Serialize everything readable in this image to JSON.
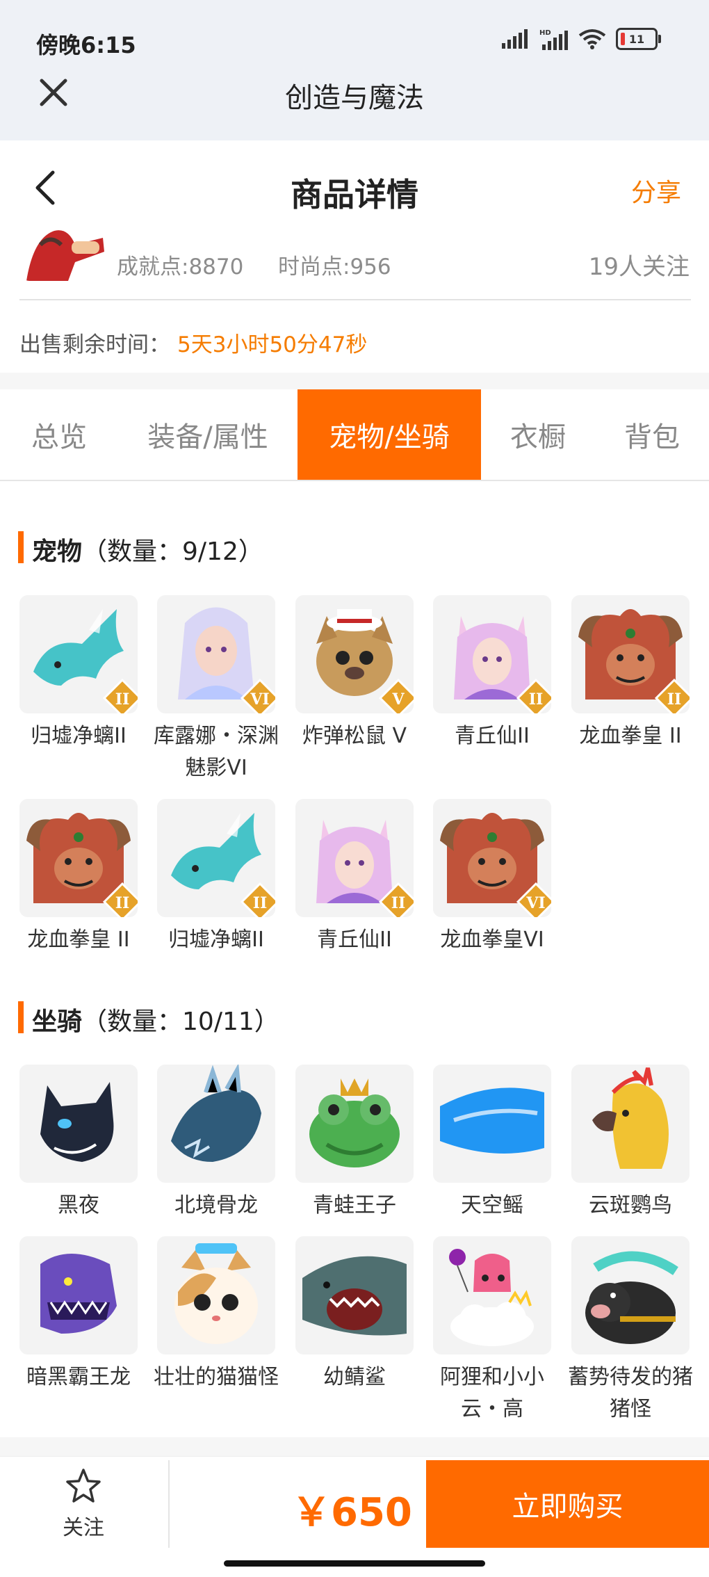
{
  "status_bar": {
    "time": "傍晚6:15",
    "battery": "11"
  },
  "app_bar": {
    "title": "创造与魔法"
  },
  "header": {
    "title": "商品详情",
    "share_label": "分享"
  },
  "profile": {
    "achievement": "成就点:8870",
    "fashion": "时尚点:956",
    "followers": "19人关注",
    "remain_label": "出售剩余时间：",
    "remain_time": "5天3小时50分47秒"
  },
  "tabs": [
    {
      "label": "总览"
    },
    {
      "label": "装备/属性"
    },
    {
      "label": "宠物/坐骑"
    },
    {
      "label": "衣橱"
    },
    {
      "label": "背包"
    }
  ],
  "active_tab": "宠物/坐骑",
  "pets": {
    "title": "宠物",
    "count": "（数量：9/12）",
    "items": [
      {
        "name": "归墟净螭II",
        "rank": "II"
      },
      {
        "name": "库露娜・深渊魅影VI",
        "rank": "VI"
      },
      {
        "name": "炸弹松鼠 V",
        "rank": "V"
      },
      {
        "name": "青丘仙II",
        "rank": "II"
      },
      {
        "name": "龙血拳皇 II",
        "rank": "II"
      },
      {
        "name": "龙血拳皇 II",
        "rank": "II"
      },
      {
        "name": "归墟净螭II",
        "rank": "II"
      },
      {
        "name": "青丘仙II",
        "rank": "II"
      },
      {
        "name": "龙血拳皇VI",
        "rank": "VI"
      }
    ]
  },
  "mounts": {
    "title": "坐骑",
    "count": "（数量：10/11）",
    "items": [
      {
        "name": "黑夜"
      },
      {
        "name": "北境骨龙"
      },
      {
        "name": "青蛙王子"
      },
      {
        "name": "天空鳐"
      },
      {
        "name": "云斑鹦鸟"
      },
      {
        "name": "暗黑霸王龙"
      },
      {
        "name": "壮壮的猫猫怪"
      },
      {
        "name": "幼鲭鲨"
      },
      {
        "name": "阿狸和小小云・高"
      },
      {
        "name": "蓄势待发的猪猪怪"
      }
    ]
  },
  "bottom": {
    "follow_label": "关注",
    "price": "￥650",
    "buy_label": "立即购买"
  },
  "colors": {
    "accent": "#ff6a00",
    "orange_text": "#f57c00"
  },
  "icons": [
    "close-icon",
    "back-icon",
    "star-icon",
    "signal-icon",
    "wifi-icon",
    "battery-icon"
  ]
}
